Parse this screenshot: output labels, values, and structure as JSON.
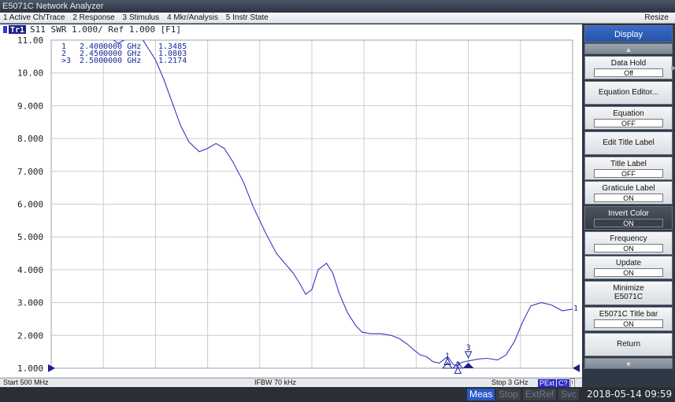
{
  "window": {
    "title": "E5071C Network Analyzer"
  },
  "menu": {
    "items": [
      "1 Active Ch/Trace",
      "2 Response",
      "3 Stimulus",
      "4 Mkr/Analysis",
      "5 Instr State"
    ],
    "resize_label": "Resize"
  },
  "trace_header": {
    "badge": "Tr1",
    "text": "S11  SWR 1.000/ Ref 1.000  [F1]"
  },
  "markers_readout": [
    {
      "num": "1",
      "freq": "2.4000000 GHz",
      "value": "1.3485"
    },
    {
      "num": "2",
      "freq": "2.4500000 GHz",
      "value": "1.0803"
    },
    {
      "num": ">3",
      "freq": "2.5000000 GHz",
      "value": "1.2174"
    }
  ],
  "chart_data": {
    "type": "line",
    "y_tick_labels": [
      "11.00",
      "10.00",
      "9.000",
      "8.000",
      "7.000",
      "6.000",
      "5.000",
      "4.000",
      "3.000",
      "2.000",
      "1.000"
    ],
    "ylim": [
      1.0,
      11.0
    ],
    "xlim": [
      0.5,
      3.0
    ],
    "x_unit": "GHz",
    "grid": true,
    "trace_color": "#3a36c0",
    "series": [
      {
        "x": [
          0.76,
          0.8,
          0.82,
          0.85,
          0.88,
          0.9,
          0.93,
          0.96,
          1.0,
          1.04,
          1.08,
          1.12,
          1.16,
          1.21,
          1.25,
          1.29,
          1.33,
          1.37,
          1.42,
          1.47,
          1.53,
          1.58,
          1.62,
          1.66,
          1.69,
          1.72,
          1.75,
          1.78,
          1.82,
          1.85,
          1.88,
          1.92,
          1.96,
          1.99,
          2.03,
          2.08,
          2.13,
          2.17,
          2.21,
          2.24,
          2.27,
          2.3,
          2.33,
          2.36,
          2.4,
          2.43,
          2.45,
          2.47,
          2.5,
          2.55,
          2.59,
          2.64,
          2.68,
          2.72,
          2.76,
          2.8,
          2.85,
          2.9,
          2.95,
          3.0
        ],
        "y": [
          11.2,
          11.0,
          10.9,
          11.0,
          11.2,
          11.3,
          11.1,
          10.8,
          10.4,
          9.8,
          9.1,
          8.4,
          7.9,
          7.6,
          7.7,
          7.85,
          7.7,
          7.3,
          6.7,
          5.9,
          5.1,
          4.5,
          4.2,
          3.9,
          3.6,
          3.25,
          3.4,
          4.0,
          4.2,
          3.9,
          3.3,
          2.7,
          2.3,
          2.1,
          2.05,
          2.05,
          2.0,
          1.9,
          1.72,
          1.55,
          1.4,
          1.35,
          1.2,
          1.15,
          1.35,
          1.1,
          1.08,
          1.18,
          1.22,
          1.28,
          1.3,
          1.25,
          1.4,
          1.8,
          2.4,
          2.9,
          3.0,
          2.92,
          2.75,
          2.8
        ]
      }
    ],
    "markers": [
      {
        "label": "1",
        "x": 2.4,
        "y": 1.3485,
        "placement": "below-trace"
      },
      {
        "label": "2",
        "x": 2.45,
        "y": 1.0803,
        "placement": "below-trace"
      },
      {
        "label": "3",
        "x": 2.5,
        "y": 1.2174,
        "placement": "above-trace",
        "active": true
      }
    ],
    "trace_end_label": "1"
  },
  "status": {
    "start": "Start 500 MHz",
    "ifbw": "IFBW 70 kHz",
    "stop": "Stop 3 GHz",
    "badges": [
      "PExt",
      "C?"
    ],
    "alert": "!"
  },
  "softkeys": {
    "header": "Display",
    "items": [
      {
        "label": "Data Hold",
        "value": "Off"
      },
      {
        "label": "Equation Editor..."
      },
      {
        "label": "Equation",
        "value": "OFF"
      },
      {
        "label": "Edit Title Label"
      },
      {
        "label": "Title Label",
        "value": "OFF"
      },
      {
        "label": "Graticule Label",
        "value": "ON"
      },
      {
        "label": "Invert Color",
        "value": "ON"
      },
      {
        "label": "Frequency",
        "value": "ON"
      },
      {
        "label": "Update",
        "value": "ON"
      },
      {
        "label": "Minimize",
        "value_text": "E5071C"
      },
      {
        "label": "E5071C Title bar",
        "value": "ON"
      },
      {
        "label": "Return"
      }
    ]
  },
  "bottom": {
    "meas": "Meas",
    "stop": "Stop",
    "extref": "ExtRef",
    "svc": "Svc",
    "datetime": "2018-05-14 09:59"
  }
}
